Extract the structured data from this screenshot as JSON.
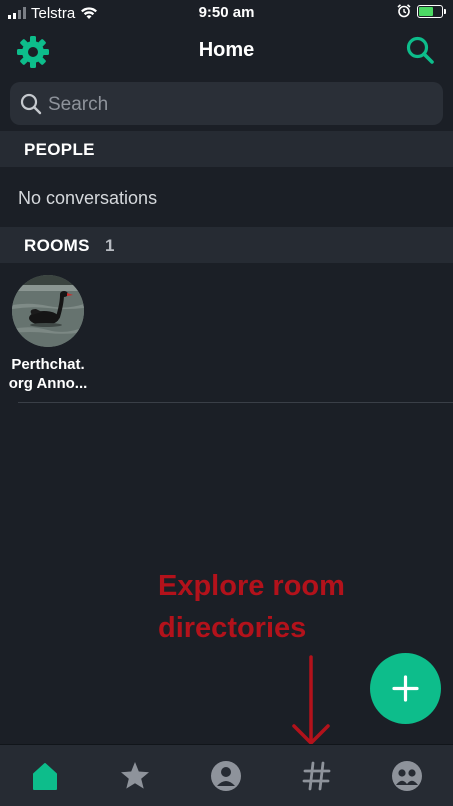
{
  "status_bar": {
    "carrier": "Telstra",
    "time": "9:50 am"
  },
  "header": {
    "title": "Home",
    "settings_icon": "gear-icon",
    "search_icon": "search-icon"
  },
  "search": {
    "placeholder": "Search"
  },
  "people": {
    "header": "PEOPLE",
    "empty_text": "No conversations"
  },
  "rooms": {
    "header": "ROOMS",
    "count": "1",
    "items": [
      {
        "name": "Perthchat.org Anno...",
        "name_line1": "Perthchat.",
        "name_line2": "org Anno..."
      }
    ]
  },
  "annotation": {
    "line1": "Explore room",
    "line2": "directories"
  },
  "fab": {
    "icon": "plus-icon"
  },
  "tabs": [
    {
      "name": "home",
      "icon": "home-icon",
      "active": true
    },
    {
      "name": "favourites",
      "icon": "star-icon",
      "active": false
    },
    {
      "name": "people",
      "icon": "person-icon",
      "active": false
    },
    {
      "name": "rooms",
      "icon": "hashtag-icon",
      "active": false
    },
    {
      "name": "communities",
      "icon": "groups-icon",
      "active": false
    }
  ],
  "colors": {
    "accent": "#0dbd8b",
    "background": "#1b1f26",
    "section": "#262b33",
    "annotation": "#b3121b"
  }
}
